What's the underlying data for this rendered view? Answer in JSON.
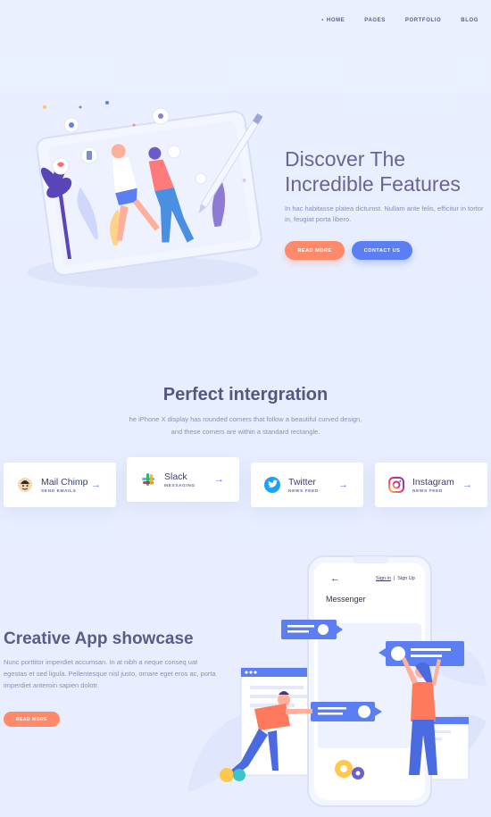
{
  "nav": {
    "items": [
      {
        "label": "HOME",
        "active": true
      },
      {
        "label": "PAGES",
        "active": false
      },
      {
        "label": "PORTFOLIO",
        "active": false
      },
      {
        "label": "BLOG",
        "active": false
      }
    ]
  },
  "hero": {
    "title_line1": "Discover The",
    "title_line2": "Incredible Features",
    "description": "In hac habitasse platea dictumst. Nullam ante felis, efficitur in tortor in, feugiat porta libero.",
    "read_more_label": "READ MORE",
    "contact_label": "CONTACT US"
  },
  "integration": {
    "title": "Perfect intergration",
    "description_line1": "he iPhone X display has rounded corners that follow a beautiful curved design,",
    "description_line2": "and these corners are within a standard rectangle.",
    "cards": [
      {
        "name": "Mail Chimp",
        "sub": "SEND EMAILS",
        "icon": "mailchimp-icon"
      },
      {
        "name": "Slack",
        "sub": "MESSAGING",
        "icon": "slack-icon"
      },
      {
        "name": "Twitter",
        "sub": "NEWS FEED",
        "icon": "twitter-icon"
      },
      {
        "name": "Instagram",
        "sub": "NEWS FEED",
        "icon": "instagram-icon"
      }
    ],
    "arrow": "→"
  },
  "showcase": {
    "title": "Creative App showcase",
    "description": "Nunc porttitor imperdiet accumsan. In at nibh a neque conseq uat egestas et sed ligula. Pellentesque nisl justo, ornare eget eros ac, porta imperdiet anteroin sapien dolotr.",
    "read_more_label": "READ MORE",
    "phone": {
      "back_arrow": "←",
      "sign_in": "Sign in",
      "separator": "|",
      "sign_up": "Sign Up",
      "screen_title": "Messenger"
    }
  },
  "colors": {
    "background": "#e9eefd",
    "accent_orange": "#ff8a6b",
    "accent_blue": "#5b7ef3",
    "text_heading": "#6b6493"
  }
}
